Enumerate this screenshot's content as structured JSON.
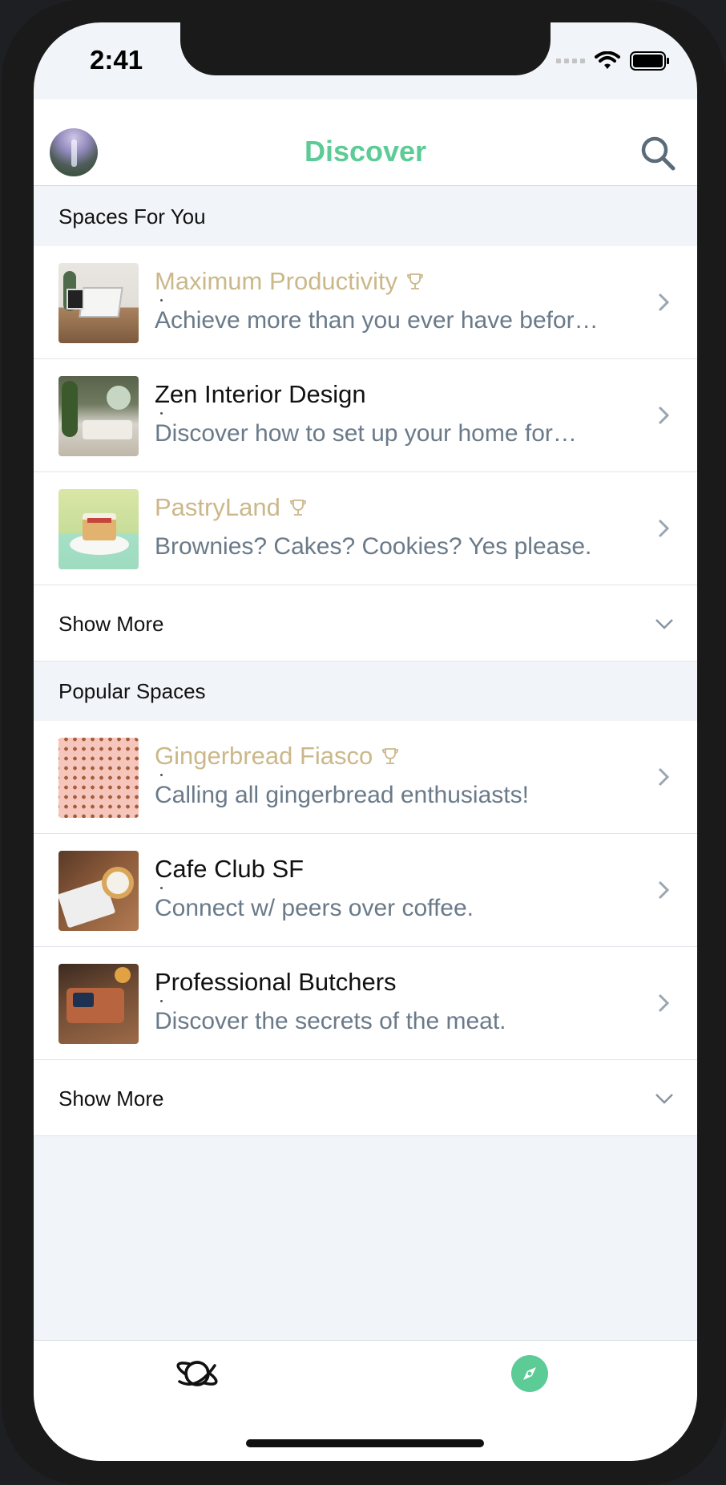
{
  "status_bar": {
    "time": "2:41"
  },
  "header": {
    "title": "Discover"
  },
  "sections": [
    {
      "heading": "Spaces For You",
      "items": [
        {
          "title": "Maximum Productivity",
          "subtitle": "Achieve more than you ever have befor…",
          "featured": true
        },
        {
          "title": "Zen Interior Design",
          "subtitle": "Discover how to set up your home for…",
          "featured": false
        },
        {
          "title": "PastryLand",
          "subtitle": "Brownies? Cakes? Cookies? Yes please.",
          "featured": true
        }
      ],
      "show_more": "Show More"
    },
    {
      "heading": "Popular Spaces",
      "items": [
        {
          "title": "Gingerbread Fiasco",
          "subtitle": "Calling all gingerbread enthusiasts!",
          "featured": true
        },
        {
          "title": "Cafe Club SF",
          "subtitle": "Connect w/ peers over coffee.",
          "featured": false
        },
        {
          "title": "Professional Butchers",
          "subtitle": "Discover the secrets of the meat.",
          "featured": false
        }
      ],
      "show_more": "Show More"
    }
  ],
  "tab_bar": {
    "tabs": [
      {
        "icon": "planet-icon",
        "active": false
      },
      {
        "icon": "compass-icon",
        "active": true
      }
    ]
  },
  "colors": {
    "accent": "#5ccb95",
    "featured_title": "#cbb88a",
    "subtitle": "#6a7a89",
    "background": "#f1f4f8"
  }
}
